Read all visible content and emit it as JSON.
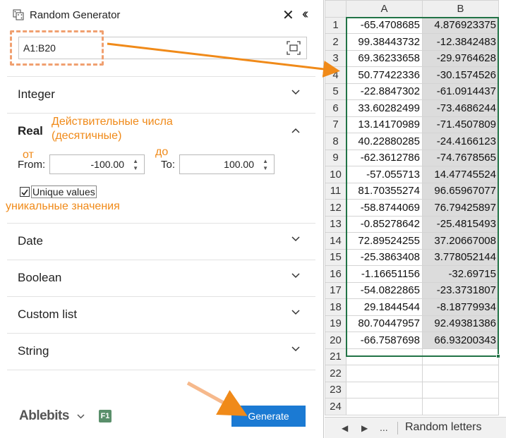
{
  "pane": {
    "title": "Random Generator",
    "range_value": "A1:B20",
    "sections": {
      "integer": "Integer",
      "real": "Real",
      "date": "Date",
      "boolean": "Boolean",
      "custom_list": "Custom list",
      "string": "String"
    },
    "real": {
      "from_label": "From:",
      "from_value": "-100.00",
      "to_label": "To:",
      "to_value": "100.00",
      "unique_label": "Unique values",
      "unique_checked": true
    },
    "annotations": {
      "real_line1": "Действительные числа",
      "real_line2": "(десятичные)",
      "from": "от",
      "to": "до",
      "unique": "уникальные значения"
    },
    "footer": {
      "brand": "Ablebits",
      "help_badge": "F1",
      "generate_label": "Generate"
    }
  },
  "sheet": {
    "columns": [
      "A",
      "B"
    ],
    "rows": [
      {
        "n": "1",
        "a": "-65.4708685",
        "b": "4.876923375"
      },
      {
        "n": "2",
        "a": "99.38443732",
        "b": "-12.3842483"
      },
      {
        "n": "3",
        "a": "69.36233658",
        "b": "-29.9764628"
      },
      {
        "n": "4",
        "a": "50.77422336",
        "b": "-30.1574526"
      },
      {
        "n": "5",
        "a": "-22.8847302",
        "b": "-61.0914437"
      },
      {
        "n": "6",
        "a": "33.60282499",
        "b": "-73.4686244"
      },
      {
        "n": "7",
        "a": "13.14170989",
        "b": "-71.4507809"
      },
      {
        "n": "8",
        "a": "40.22880285",
        "b": "-24.4166123"
      },
      {
        "n": "9",
        "a": "-62.3612786",
        "b": "-74.7678565"
      },
      {
        "n": "10",
        "a": "-57.055713",
        "b": "14.47745524"
      },
      {
        "n": "11",
        "a": "81.70355274",
        "b": "96.65967077"
      },
      {
        "n": "12",
        "a": "-58.8744069",
        "b": "76.79425897"
      },
      {
        "n": "13",
        "a": "-0.85278642",
        "b": "-25.4815493"
      },
      {
        "n": "14",
        "a": "72.89524255",
        "b": "37.20667008"
      },
      {
        "n": "15",
        "a": "-25.3863408",
        "b": "3.778052144"
      },
      {
        "n": "16",
        "a": "-1.16651156",
        "b": "-32.69715"
      },
      {
        "n": "17",
        "a": "-54.0822865",
        "b": "-23.3731807"
      },
      {
        "n": "18",
        "a": "29.1844544",
        "b": "-8.18779934"
      },
      {
        "n": "19",
        "a": "80.70447957",
        "b": "92.49381386"
      },
      {
        "n": "20",
        "a": "-66.7587698",
        "b": "66.93200343"
      },
      {
        "n": "21",
        "a": "",
        "b": ""
      },
      {
        "n": "22",
        "a": "",
        "b": ""
      },
      {
        "n": "23",
        "a": "",
        "b": ""
      },
      {
        "n": "24",
        "a": "",
        "b": ""
      }
    ],
    "tabbar": {
      "more": "...",
      "sheet_tab": "Random letters"
    }
  },
  "colors": {
    "accent": "#1b7ad3",
    "annotation": "#f08a19",
    "selection": "#217346",
    "brand_badge": "#5a8f6b"
  }
}
